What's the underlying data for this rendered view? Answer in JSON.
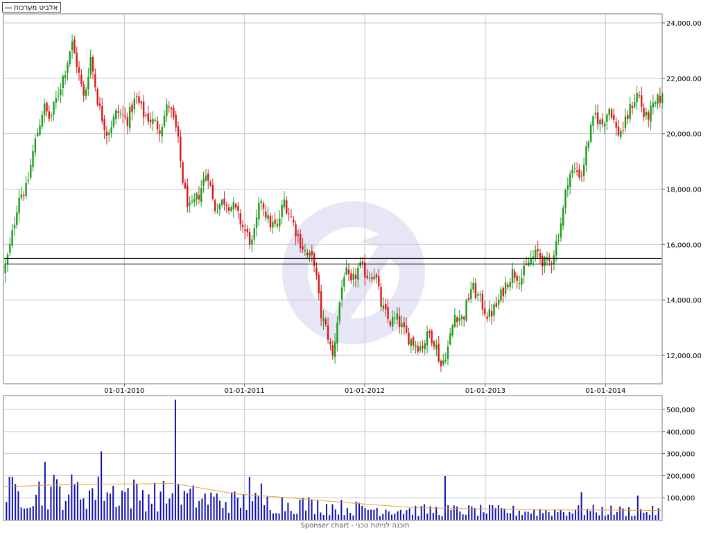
{
  "legend": {
    "label": "אלביט מערכות"
  },
  "footer": {
    "text": "Sponser chart - תוכנה לניתוח טכני"
  },
  "colors": {
    "up": "#1a9a1a",
    "down": "#d81818",
    "volume": "#1010b0",
    "volume_ma": "#f0a020",
    "grid": "#c4c4d4",
    "support": "#000000",
    "watermark": "#e6e6f6"
  },
  "chart_data": [
    {
      "type": "candlestick",
      "title": "",
      "x_tick_labels": [
        "01-01-2010",
        "01-01-2011",
        "01-01-2012",
        "01-01-2013",
        "01-01-2014"
      ],
      "x_tick_dates": [
        "2010-01-01",
        "2011-01-01",
        "2012-01-01",
        "2013-01-01",
        "2014-01-01"
      ],
      "x_range": [
        "2009-01-01",
        "2014-06-20"
      ],
      "y_tick_labels": [
        "12,000.00",
        "14,000.00",
        "16,000.00",
        "18,000.00",
        "20,000.00",
        "22,000.00",
        "24,000.00"
      ],
      "y_ticks": [
        12000,
        14000,
        16000,
        18000,
        20000,
        22000,
        24000
      ],
      "ylim": [
        11000,
        24300
      ],
      "horizontal_lines": [
        15500,
        15300
      ],
      "grid": true,
      "close_path": [
        [
          "2009-01-01",
          15000
        ],
        [
          "2009-01-20",
          16000
        ],
        [
          "2009-02-15",
          17800
        ],
        [
          "2009-03-10",
          18000
        ],
        [
          "2009-04-01",
          19500
        ],
        [
          "2009-05-01",
          21000
        ],
        [
          "2009-05-20",
          20500
        ],
        [
          "2009-06-15",
          21500
        ],
        [
          "2009-07-10",
          22500
        ],
        [
          "2009-07-25",
          23300
        ],
        [
          "2009-08-10",
          22500
        ],
        [
          "2009-09-01",
          21200
        ],
        [
          "2009-09-20",
          22800
        ],
        [
          "2009-10-15",
          21000
        ],
        [
          "2009-11-10",
          20000
        ],
        [
          "2009-12-10",
          20800
        ],
        [
          "2010-01-10",
          20500
        ],
        [
          "2010-02-05",
          21300
        ],
        [
          "2010-03-01",
          20700
        ],
        [
          "2010-04-01",
          20400
        ],
        [
          "2010-04-20",
          20200
        ],
        [
          "2010-05-15",
          21100
        ],
        [
          "2010-06-10",
          20000
        ],
        [
          "2010-07-01",
          18000
        ],
        [
          "2010-07-20",
          17200
        ],
        [
          "2010-08-15",
          17800
        ],
        [
          "2010-09-10",
          18700
        ],
        [
          "2010-10-01",
          17300
        ],
        [
          "2010-11-01",
          17600
        ],
        [
          "2010-12-01",
          17300
        ],
        [
          "2011-01-01",
          16500
        ],
        [
          "2011-01-25",
          16000
        ],
        [
          "2011-02-20",
          17700
        ],
        [
          "2011-03-15",
          16800
        ],
        [
          "2011-04-10",
          16600
        ],
        [
          "2011-05-01",
          17600
        ],
        [
          "2011-05-25",
          16900
        ],
        [
          "2011-06-15",
          16200
        ],
        [
          "2011-07-10",
          15600
        ],
        [
          "2011-08-01",
          15400
        ],
        [
          "2011-08-20",
          13500
        ],
        [
          "2011-09-10",
          12800
        ],
        [
          "2011-09-25",
          11900
        ],
        [
          "2011-10-15",
          13800
        ],
        [
          "2011-11-01",
          15100
        ],
        [
          "2011-11-20",
          14500
        ],
        [
          "2011-12-15",
          15200
        ],
        [
          "2012-01-10",
          14900
        ],
        [
          "2012-02-01",
          15000
        ],
        [
          "2012-02-20",
          13800
        ],
        [
          "2012-03-15",
          13200
        ],
        [
          "2012-04-10",
          13300
        ],
        [
          "2012-05-01",
          12800
        ],
        [
          "2012-05-25",
          12500
        ],
        [
          "2012-06-20",
          12300
        ],
        [
          "2012-07-15",
          12800
        ],
        [
          "2012-08-01",
          12500
        ],
        [
          "2012-08-20",
          11600
        ],
        [
          "2012-09-10",
          12300
        ],
        [
          "2012-10-01",
          13500
        ],
        [
          "2012-10-25",
          13300
        ],
        [
          "2012-11-20",
          14500
        ],
        [
          "2012-12-15",
          14000
        ],
        [
          "2013-01-10",
          13400
        ],
        [
          "2013-02-05",
          13800
        ],
        [
          "2013-03-01",
          14500
        ],
        [
          "2013-03-25",
          15000
        ],
        [
          "2013-04-20",
          14800
        ],
        [
          "2013-05-15",
          15400
        ],
        [
          "2013-06-10",
          15700
        ],
        [
          "2013-07-01",
          15300
        ],
        [
          "2013-07-20",
          15400
        ],
        [
          "2013-08-10",
          16300
        ],
        [
          "2013-08-25",
          17200
        ],
        [
          "2013-09-10",
          18500
        ],
        [
          "2013-10-01",
          18700
        ],
        [
          "2013-10-20",
          18500
        ],
        [
          "2013-11-10",
          19800
        ],
        [
          "2013-12-01",
          20700
        ],
        [
          "2013-12-20",
          20300
        ],
        [
          "2014-01-15",
          21000
        ],
        [
          "2014-02-05",
          20000
        ],
        [
          "2014-02-25",
          20200
        ],
        [
          "2014-03-20",
          21000
        ],
        [
          "2014-04-10",
          21500
        ],
        [
          "2014-05-01",
          20500
        ],
        [
          "2014-05-25",
          20900
        ],
        [
          "2014-06-15",
          21300
        ]
      ]
    },
    {
      "type": "bar",
      "title": "",
      "y_tick_labels": [
        "100,000",
        "200,000",
        "300,000",
        "400,000",
        "500,000"
      ],
      "y_ticks": [
        100000,
        200000,
        300000,
        400000,
        500000
      ],
      "ylim": [
        0,
        560000
      ],
      "volume_profile": [
        [
          "2009-01-01",
          160000
        ],
        [
          "2009-06-01",
          175000
        ],
        [
          "2009-12-01",
          165000
        ],
        [
          "2010-06-01",
          140000
        ],
        [
          "2010-12-01",
          110000
        ],
        [
          "2011-06-01",
          95000
        ],
        [
          "2011-12-01",
          70000
        ],
        [
          "2012-06-01",
          58000
        ],
        [
          "2012-12-01",
          55000
        ],
        [
          "2013-06-01",
          52000
        ],
        [
          "2013-12-01",
          55000
        ],
        [
          "2014-06-20",
          50000
        ]
      ],
      "spikes": [
        [
          "2009-05-05",
          262000
        ],
        [
          "2009-10-20",
          310000
        ],
        [
          "2010-06-01",
          545000
        ],
        [
          "2012-09-01",
          198000
        ],
        [
          "2011-01-20",
          195000
        ],
        [
          "2011-02-20",
          165000
        ],
        [
          "2013-10-20",
          125000
        ],
        [
          "2014-04-10",
          110000
        ]
      ],
      "moving_average": [
        [
          "2009-01-01",
          150000
        ],
        [
          "2009-06-01",
          158000
        ],
        [
          "2009-12-01",
          162000
        ],
        [
          "2010-06-01",
          165000
        ],
        [
          "2010-12-01",
          118000
        ],
        [
          "2011-06-01",
          98000
        ],
        [
          "2011-12-01",
          75000
        ],
        [
          "2012-06-01",
          55000
        ],
        [
          "2012-12-01",
          50000
        ],
        [
          "2013-06-01",
          45000
        ],
        [
          "2013-12-01",
          45000
        ],
        [
          "2014-06-20",
          42000
        ]
      ]
    }
  ]
}
